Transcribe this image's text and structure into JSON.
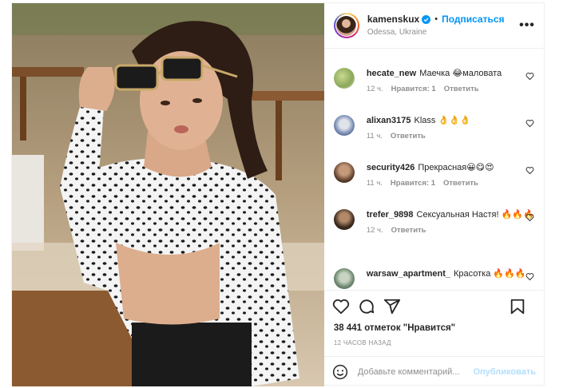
{
  "header": {
    "username": "kamenskux",
    "separator": "•",
    "follow_label": "Подписаться",
    "location": "Odessa, Ukraine",
    "more_icon": "more-horizontal-icon",
    "more_glyph": "•••"
  },
  "comments": [
    {
      "username": "hecate_new",
      "text": "Маечка 😂маловата",
      "time": "12 ч.",
      "likes": "Нравится: 1",
      "reply": "Ответить"
    },
    {
      "username": "alixan3175",
      "text": "Klass 👌👌👌",
      "time": "11 ч.",
      "likes": "",
      "reply": "Ответить"
    },
    {
      "username": "security426",
      "text": "Прекрасная😀😋😍",
      "time": "11 ч.",
      "likes": "Нравится: 1",
      "reply": "Ответить"
    },
    {
      "username": "trefer_9898",
      "text": "Сексуальная Настя! 🔥🔥🔥",
      "time": "12 ч.",
      "likes": "",
      "reply": "Ответить"
    },
    {
      "username": "warsaw_apartment_",
      "text": "Красотка 🔥🔥🔥",
      "time": "",
      "likes": "",
      "reply": ""
    }
  ],
  "actions": {
    "icons": [
      "heart-icon",
      "comment-icon",
      "share-icon",
      "bookmark-icon"
    ]
  },
  "likes_text": "38 441 отметок \"Нравится\"",
  "age_text": "12 ЧАСОВ НАЗАД",
  "add_comment": {
    "placeholder": "Добавьте комментарий...",
    "publish_label": "Опубликовать"
  },
  "colors": {
    "accent": "#0095f6",
    "publish_disabled": "#b2dffc",
    "meta_gray": "#8e8e8e"
  }
}
